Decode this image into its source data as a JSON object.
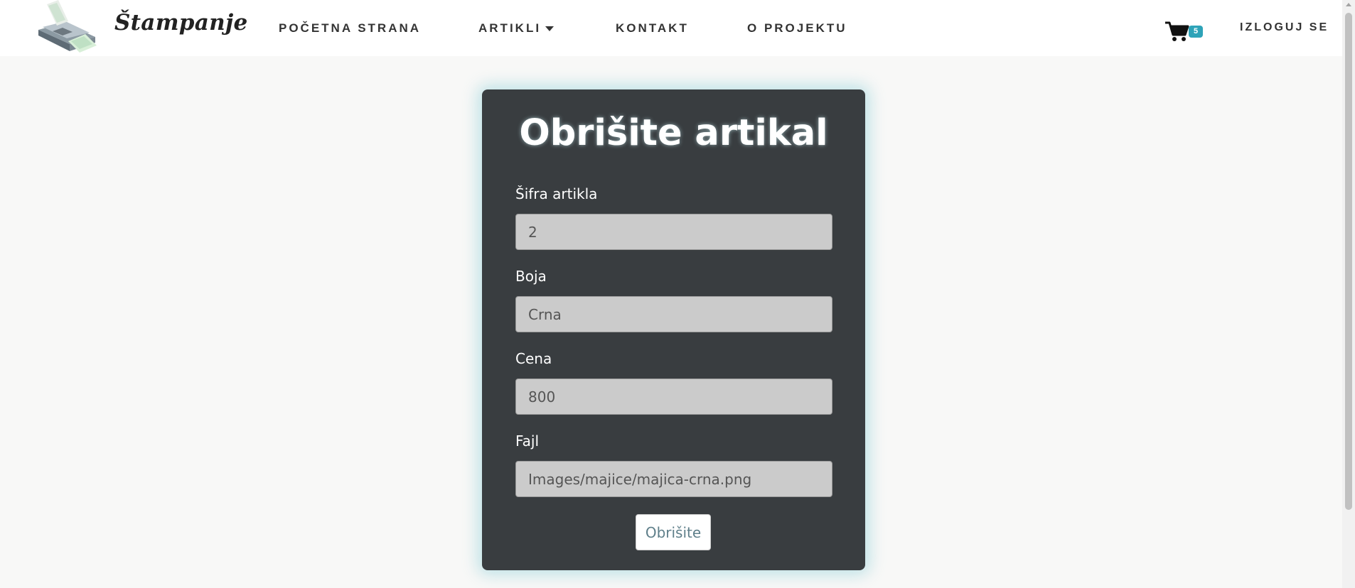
{
  "header": {
    "brand": "Štampanje",
    "logo_icon": "printer-icon",
    "nav": [
      {
        "label": "POČETNA STRANA"
      },
      {
        "label": "ARTIKLI"
      },
      {
        "label": "KONTAKT"
      },
      {
        "label": "O PROJEKTU"
      }
    ],
    "cart_icon": "shopping-cart-icon",
    "cart_count": "5",
    "logout_label": "IZLOGUJ SE"
  },
  "form": {
    "title": "Obrišite artikal",
    "fields": [
      {
        "label": "Šifra artikla",
        "value": "2"
      },
      {
        "label": "Boja",
        "value": "Crna"
      },
      {
        "label": "Cena",
        "value": "800"
      },
      {
        "label": "Fajl",
        "value": "Images/majice/majica-crna.png"
      }
    ],
    "submit_label": "Obrišite"
  },
  "colors": {
    "card_background": "#393d40",
    "page_background": "#f8f8f7",
    "badge": "#2ea3b8",
    "input_background": "#cbcbcb"
  }
}
